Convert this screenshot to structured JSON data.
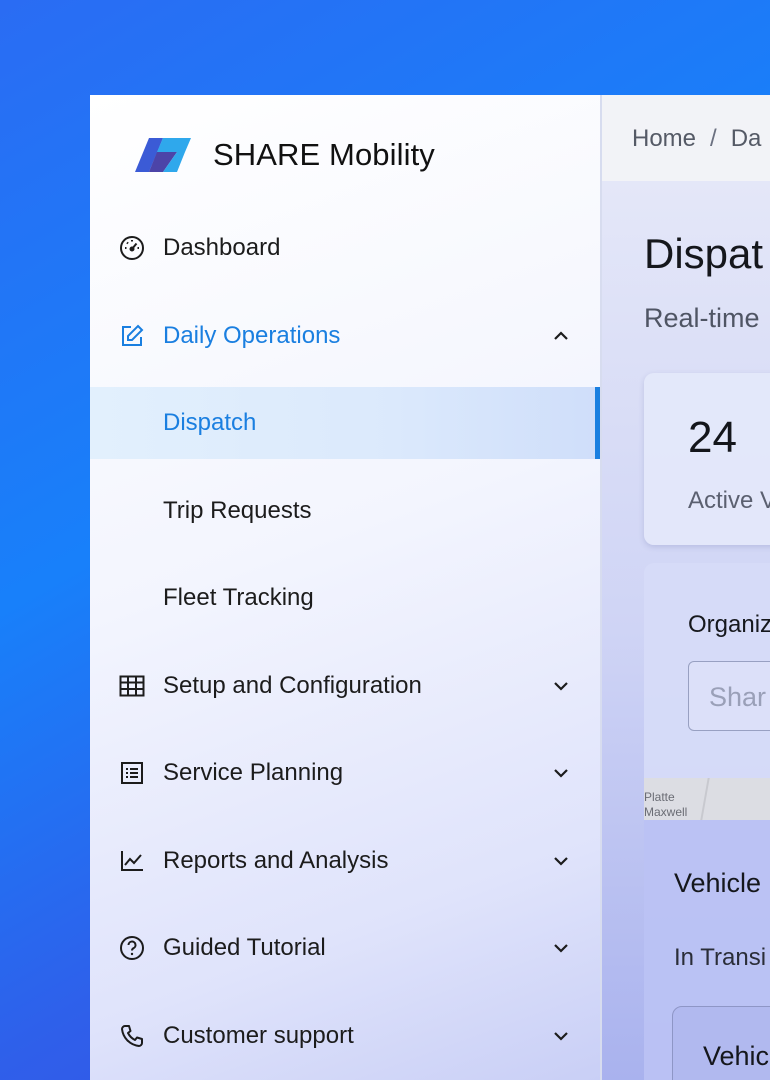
{
  "brand": {
    "name": "SHARE Mobility"
  },
  "colors": {
    "accent": "#1a7fe0",
    "text": "#1c1c1c"
  },
  "sidebar": {
    "items": [
      {
        "label": "Dashboard",
        "icon": "dashboard-gauge-icon"
      },
      {
        "label": "Daily Operations",
        "icon": "edit-square-icon",
        "expanded": true
      },
      {
        "label": "Dispatch",
        "selected": true
      },
      {
        "label": "Trip Requests"
      },
      {
        "label": "Fleet Tracking"
      },
      {
        "label": "Setup and Configuration",
        "icon": "table-grid-icon"
      },
      {
        "label": "Service Planning",
        "icon": "list-alt-icon"
      },
      {
        "label": "Reports and Analysis",
        "icon": "line-chart-icon"
      },
      {
        "label": "Guided Tutorial",
        "icon": "help-circle-icon"
      },
      {
        "label": "Customer support",
        "icon": "phone-icon"
      }
    ]
  },
  "header": {
    "breadcrumb": {
      "home": "Home",
      "separator": "/",
      "current": "Da"
    }
  },
  "main": {
    "title": "Dispat",
    "subtitle": "Real-time",
    "stat": {
      "value": "24",
      "label": "Active V"
    },
    "filter": {
      "label": "Organiz",
      "input_value": "Shar"
    },
    "map": {
      "label1": "Platte",
      "label2": "Maxwell"
    },
    "vehicles": {
      "title": "Vehicle",
      "subtitle": "In Transi",
      "card_title": "Vehic"
    }
  }
}
